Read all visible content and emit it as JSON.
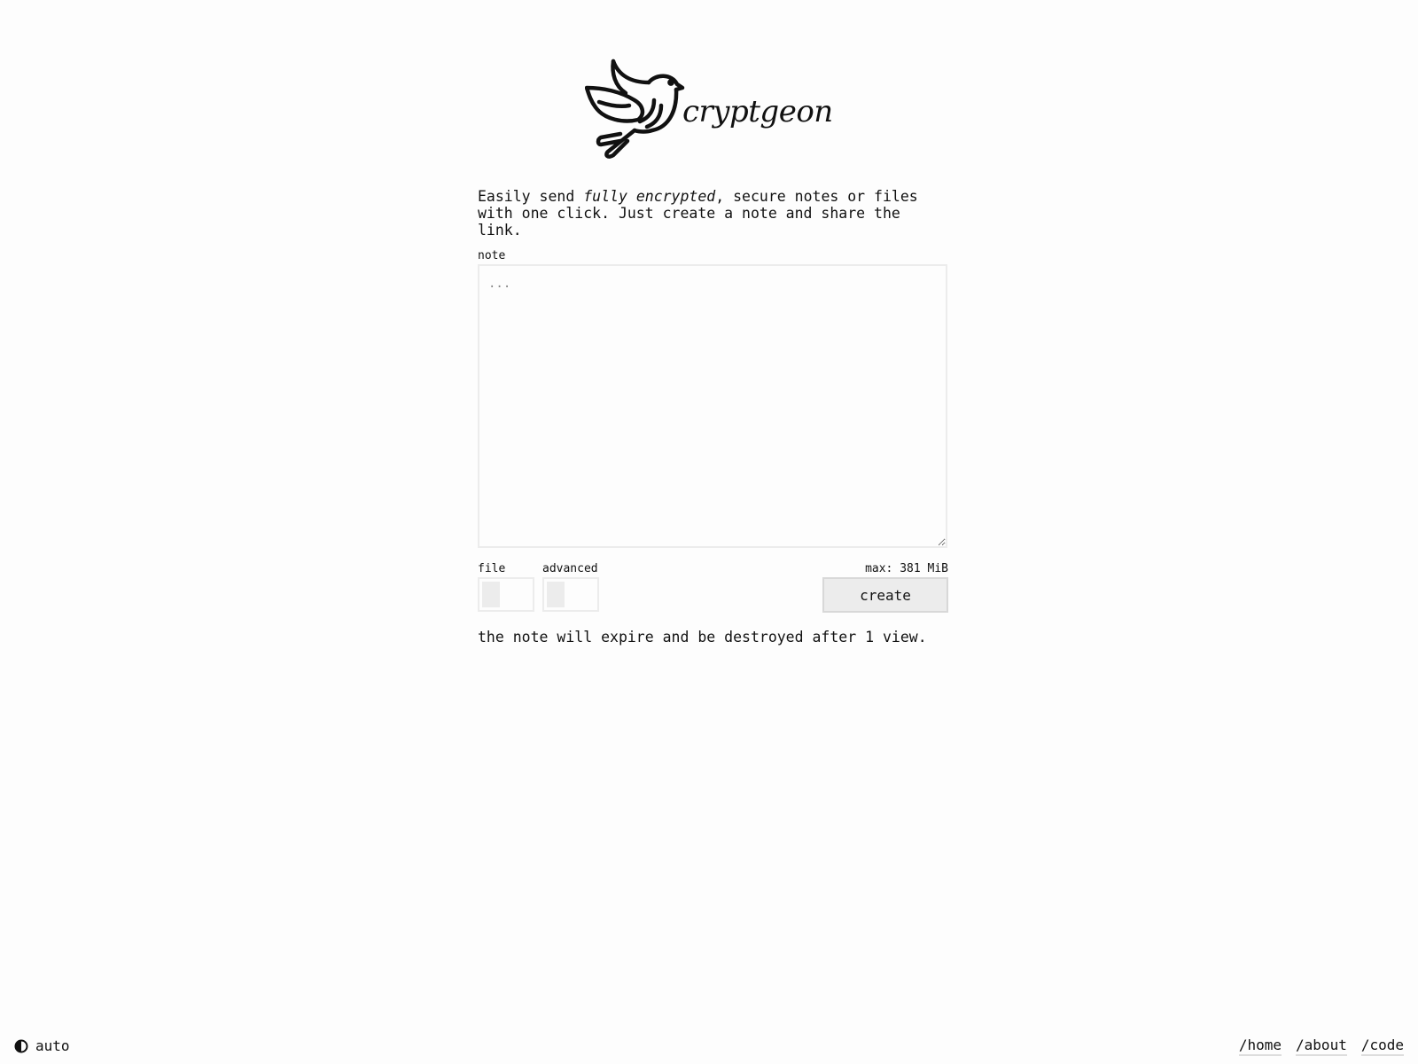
{
  "logo": {
    "text": "cryptgeon"
  },
  "intro": {
    "prefix": "Easily send ",
    "emphasis": "fully encrypted",
    "suffix": ", secure notes or files\nwith one click. Just create a note and share the link."
  },
  "note": {
    "label": "note",
    "placeholder": "...",
    "value": ""
  },
  "options": {
    "file_label": "file",
    "file_enabled": false,
    "advanced_label": "advanced",
    "advanced_enabled": false,
    "max_label": "max: 381 MiB"
  },
  "actions": {
    "create_label": "create"
  },
  "expire_text": "the note will expire and be destroyed after 1 view.",
  "footer": {
    "theme_label": "auto",
    "theme_icon": "half-circle-icon",
    "links": [
      {
        "label": "/home"
      },
      {
        "label": "/about"
      },
      {
        "label": "/code"
      }
    ]
  }
}
